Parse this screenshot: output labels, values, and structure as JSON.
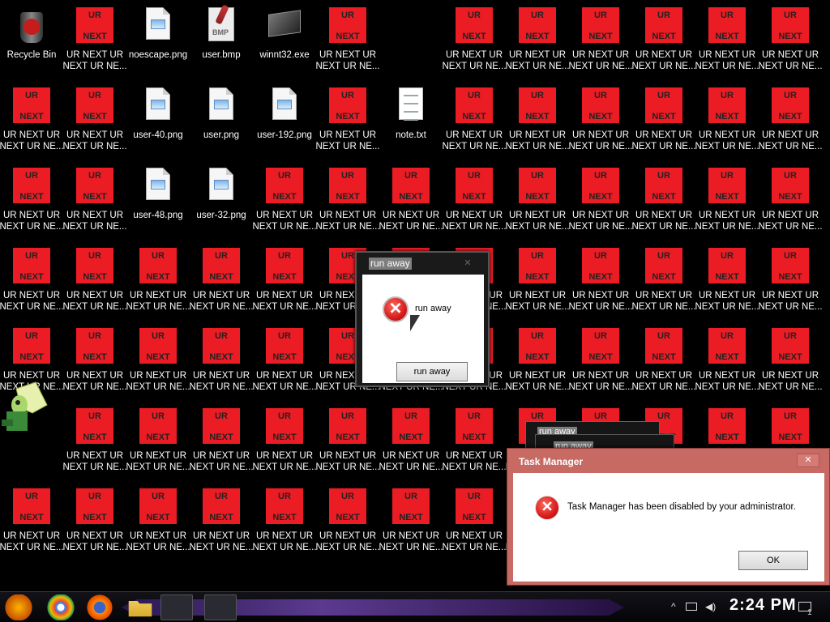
{
  "desktop": {
    "recycle_label": "Recycle Bin",
    "files": {
      "noescape": "noescape.png",
      "user_bmp": "user.bmp",
      "winnt32": "winnt32.exe",
      "user40": "user-40.png",
      "user_png": "user.png",
      "user192": "user-192.png",
      "note": "note.txt",
      "user48": "user-48.png",
      "user32": "user-32.png"
    },
    "ur_top": "UR",
    "ur_bottom": "NEXT",
    "ur_label": "UR NEXT UR\nNEXT UR NE..."
  },
  "run_away_dialog": {
    "title": "run away",
    "message": "run away",
    "button": "run away",
    "close": "✕"
  },
  "stacked_dialogs": [
    "run away",
    "run away"
  ],
  "task_manager_dialog": {
    "title": "Task Manager",
    "message": "Task Manager has been disabled by your administrator.",
    "ok": "OK",
    "close": "✕"
  },
  "taskbar": {
    "clock": "2:24 PM",
    "notification_count": "1",
    "tray_up": "^"
  },
  "colors": {
    "ur_red": "#ec1c24",
    "dialog_frame": "#c86a64"
  }
}
